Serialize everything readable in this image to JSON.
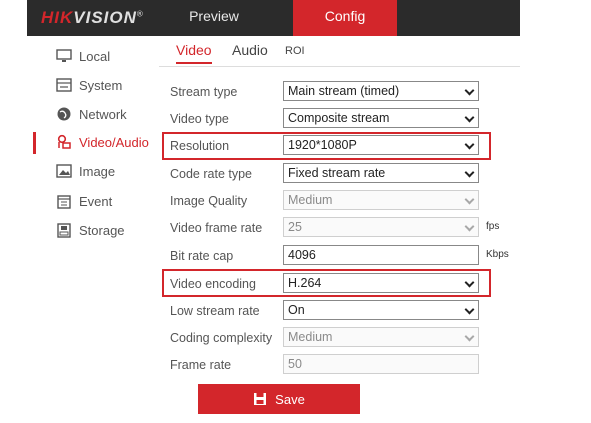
{
  "brand": {
    "logo_red": "HIK",
    "logo_rest": "VISION",
    "logo_mark": "®"
  },
  "nav": {
    "preview": "Preview",
    "config": "Config"
  },
  "sidebar": {
    "items": [
      {
        "label": "Local",
        "icon": "monitor-icon"
      },
      {
        "label": "System",
        "icon": "system-icon"
      },
      {
        "label": "Network",
        "icon": "globe-icon"
      },
      {
        "label": "Video/Audio",
        "icon": "video-audio-icon",
        "active": true
      },
      {
        "label": "Image",
        "icon": "image-icon"
      },
      {
        "label": "Event",
        "icon": "calendar-icon"
      },
      {
        "label": "Storage",
        "icon": "storage-icon"
      }
    ]
  },
  "tabs": {
    "video": "Video",
    "audio": "Audio",
    "roi": "ROI"
  },
  "form": {
    "stream_type": {
      "label": "Stream type",
      "value": "Main stream (timed)"
    },
    "video_type": {
      "label": "Video type",
      "value": "Composite stream"
    },
    "resolution": {
      "label": "Resolution",
      "value": "1920*1080P"
    },
    "code_rate_type": {
      "label": "Code rate type",
      "value": "Fixed stream rate"
    },
    "image_quality": {
      "label": "Image Quality",
      "value": "Medium"
    },
    "video_frame_rate": {
      "label": "Video frame rate",
      "value": "25",
      "unit": "fps"
    },
    "bit_rate_cap": {
      "label": "Bit rate cap",
      "value": "4096",
      "unit": "Kbps"
    },
    "video_encoding": {
      "label": "Video encoding",
      "value": "H.264"
    },
    "low_stream_rate": {
      "label": "Low stream rate",
      "value": "On"
    },
    "coding_complexity": {
      "label": "Coding complexity",
      "value": "Medium"
    },
    "frame_rate": {
      "label": "Frame rate",
      "value": "50"
    }
  },
  "save_label": "Save",
  "colors": {
    "accent": "#d3262b",
    "topbar": "#2b2b2b"
  }
}
